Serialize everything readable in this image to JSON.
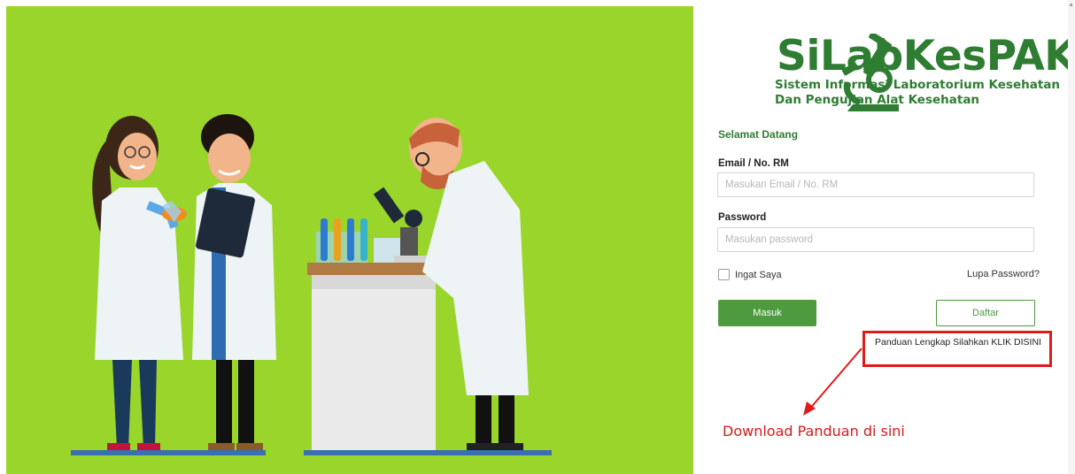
{
  "app": {
    "brand": "SiLabKesPAK",
    "subtitle_line1": "Sistem Informasi Laboratorium Kesehatan",
    "subtitle_line2": "Dan Pengujian Alat Kesehatan"
  },
  "login": {
    "welcome": "Selamat Datang",
    "email_label": "Email / No. RM",
    "email_placeholder": "Masukan Email / No. RM",
    "email_value": "",
    "password_label": "Password",
    "password_placeholder": "Masukan password",
    "password_value": "",
    "remember_label": "Ingat Saya",
    "remember_checked": false,
    "forgot_label": "Lupa Password?",
    "login_button": "Masuk",
    "register_button": "Daftar"
  },
  "guide": {
    "link_text": "Panduan Lengkap Silahkan KLIK DISINI",
    "annotation": "Download Panduan di sini"
  },
  "colors": {
    "brand_green": "#2f7d32",
    "button_green": "#4e9a3f",
    "hero_background": "#99d52a",
    "annotation_red": "#e01a1a"
  },
  "icons": {
    "logo": "microscope-icon",
    "arrow": "arrow-icon",
    "checkbox": "checkbox-icon"
  }
}
